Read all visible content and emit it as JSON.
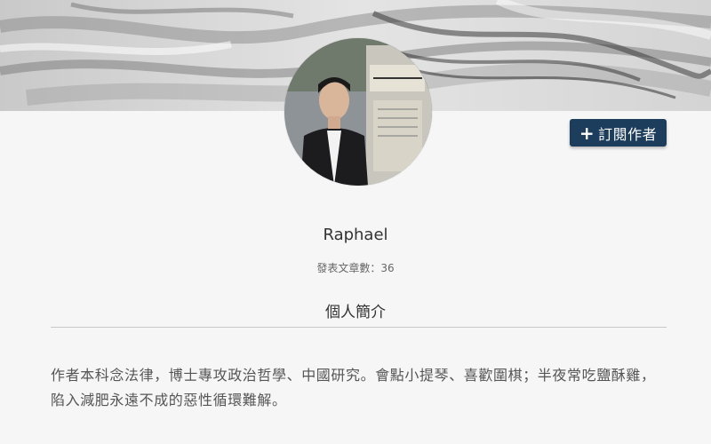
{
  "header": {
    "subscribe_label": "訂閱作者",
    "plus_icon": "plus-icon"
  },
  "profile": {
    "name": "Raphael",
    "post_count": "發表文章數：36"
  },
  "bio": {
    "title": "個人簡介",
    "text": "作者本科念法律，博士專攻政治哲學、中國研究。會點小提琴、喜歡圍棋；半夜常吃鹽酥雞，陷入減肥永遠不成的惡性循環難解。"
  },
  "colors": {
    "subscribe_bg": "#1d3d5c",
    "page_bg": "#f6f6f6"
  }
}
